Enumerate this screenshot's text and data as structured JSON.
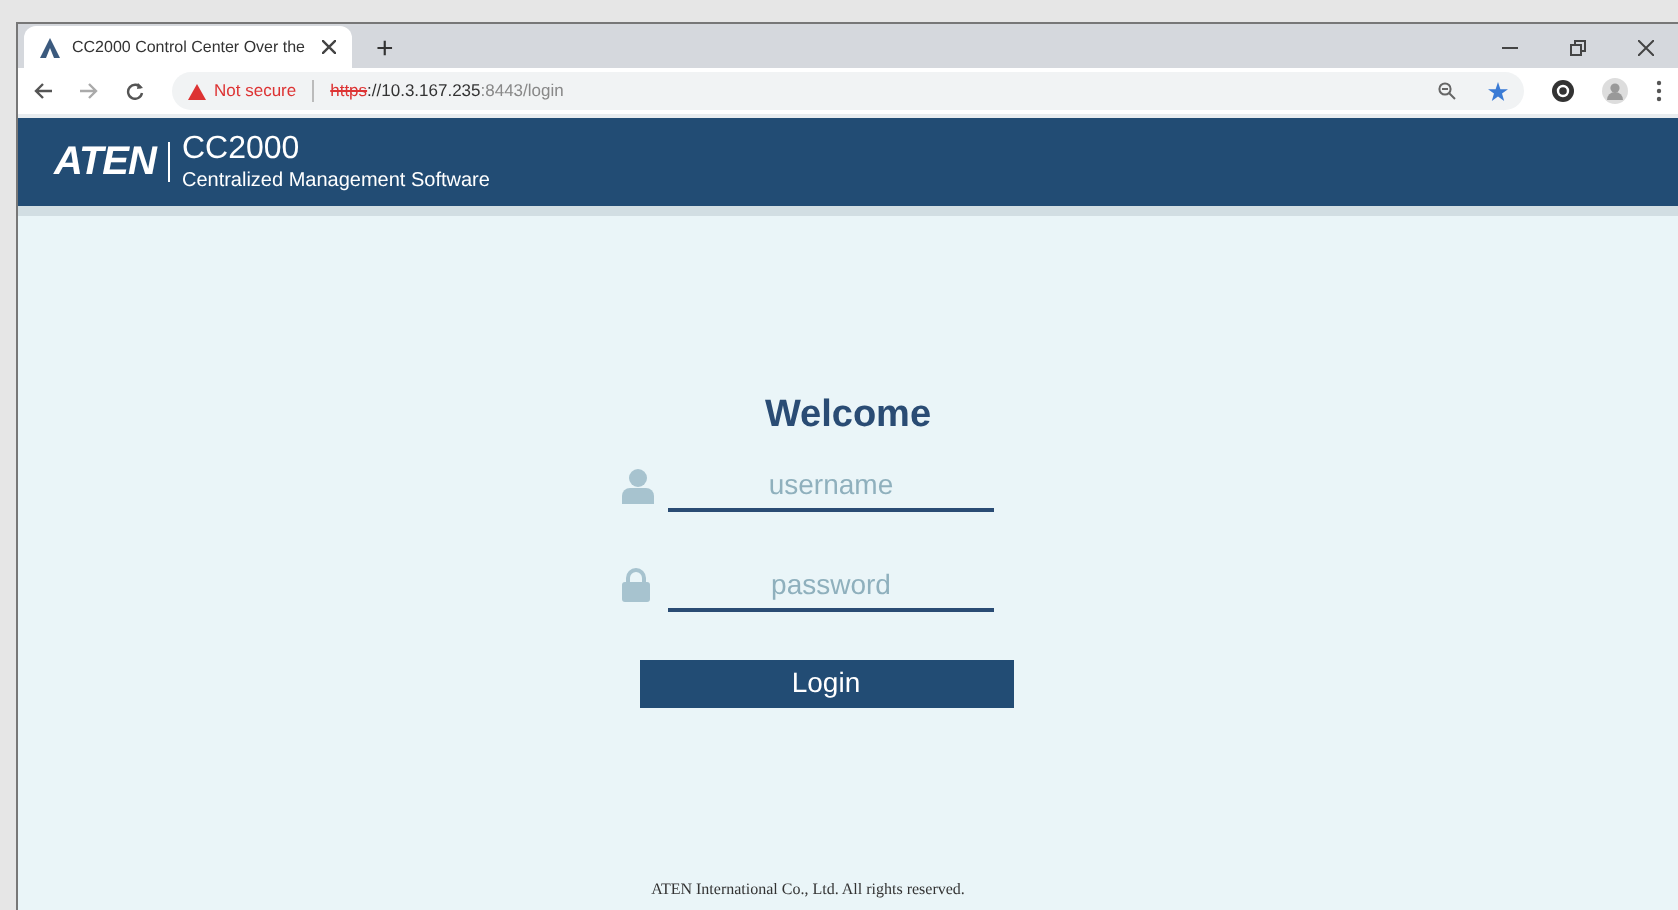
{
  "browser": {
    "tab": {
      "title": "CC2000 Control Center Over the",
      "selected": true
    },
    "new_tab": "+",
    "security": "Not secure",
    "url": {
      "scheme": "https",
      "host": "://10.3.167.235",
      "rest": ":8443/login"
    }
  },
  "header": {
    "logo": "ATEN",
    "product": "CC2000",
    "subtitle": "Centralized Management Software"
  },
  "login": {
    "title": "Welcome",
    "username": {
      "placeholder": "username"
    },
    "password": {
      "placeholder": "password"
    },
    "button": "Login"
  },
  "footer": "ATEN International Co., Ltd. All rights reserved."
}
